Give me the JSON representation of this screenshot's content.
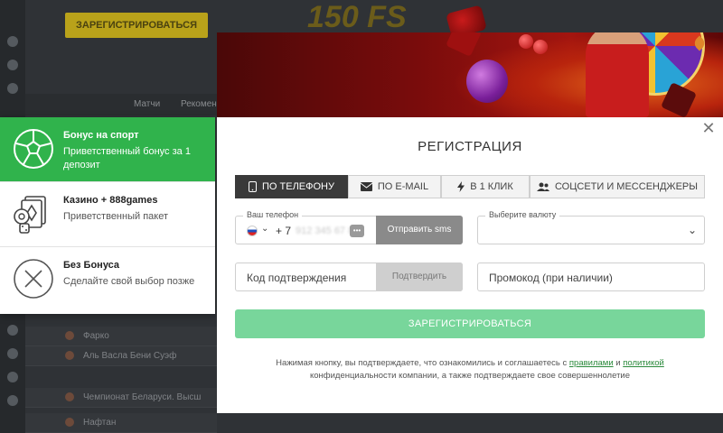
{
  "background": {
    "top_button": "ЗАРЕГИСТРИРОВАТЬСЯ",
    "promo_number": "150 FS",
    "tabs": [
      "Матчи",
      "Рекомен"
    ],
    "rows": [
      "Фарко",
      "Аль Васла Бени Суэф",
      "Чемпионат Беларуси. Высш",
      "Нафтан"
    ]
  },
  "bonus": {
    "items": [
      {
        "title": "Бонус на спорт",
        "subtitle": "Приветственный бонус за 1 депозит"
      },
      {
        "title": "Казино + 888games",
        "subtitle": "Приветственный пакет"
      },
      {
        "title": "Без Бонуса",
        "subtitle": "Сделайте свой выбор позже"
      }
    ]
  },
  "modal": {
    "title": "РЕГИСТРАЦИЯ",
    "close_label": "✕",
    "tabs": [
      {
        "label": "ПО ТЕЛЕФОНУ",
        "icon": "phone-icon"
      },
      {
        "label": "ПО E-MAIL",
        "icon": "envelope-icon"
      },
      {
        "label": "В 1 КЛИК",
        "icon": "lightning-icon"
      },
      {
        "label": "СОЦСЕТИ И МЕССЕНДЖЕРЫ",
        "icon": "users-icon"
      }
    ],
    "phone": {
      "label": "Ваш телефон",
      "country_code": "+ 7",
      "number_placeholder": "912 345 67 89",
      "send_sms": "Отправить sms"
    },
    "currency": {
      "label": "Выберите валюту"
    },
    "confirmation": {
      "placeholder": "Код подтверждения",
      "button": "Подтвердить"
    },
    "promo": {
      "placeholder": "Промокод (при наличии)"
    },
    "register_button": "ЗАРЕГИСТРИРОВАТЬСЯ",
    "terms": {
      "before": "Нажимая кнопку, вы подтверждаете, что ознакомились и соглашаетесь с ",
      "rules_link": "правилами",
      "and": " и ",
      "policy_link": "политикой",
      "after": " конфиденциальности компании, а также подтверждаете свое совершеннолетие"
    }
  },
  "colors": {
    "accent_green": "#30b34c",
    "register_green": "#78d69b",
    "active_tab": "#3a3a3a",
    "link_green": "#2a8a3b"
  }
}
